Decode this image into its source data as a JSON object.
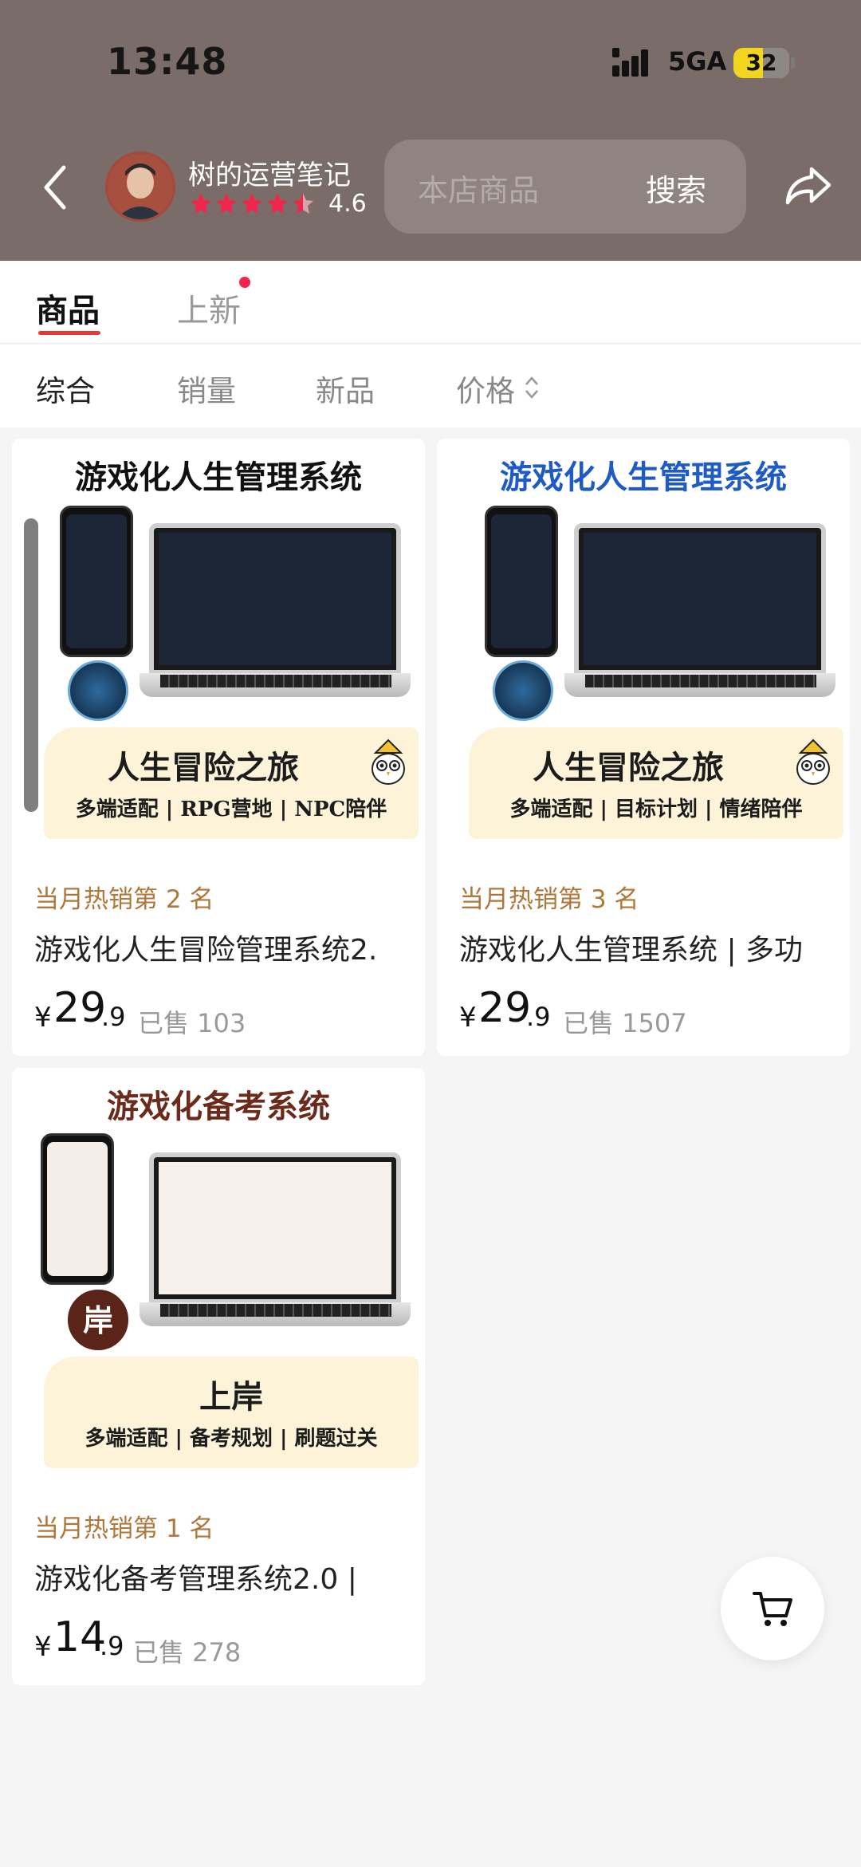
{
  "status_bar": {
    "time": "13:48",
    "network": "5GA",
    "battery": "32"
  },
  "header": {
    "shop_name": "树的运营笔记",
    "rating": "4.6",
    "search_placeholder": "本店商品",
    "search_button": "搜索"
  },
  "tabs": [
    {
      "label": "商品"
    },
    {
      "label": "上新"
    }
  ],
  "filters": [
    {
      "label": "综合"
    },
    {
      "label": "销量"
    },
    {
      "label": "新品"
    },
    {
      "label": "价格"
    }
  ],
  "products": [
    {
      "image_title": "游戏化人生管理系统",
      "image_title_color": "#111111",
      "banner_main": "人生冒险之旅",
      "banner_sub": "多端适配 | RPG营地 | NPC陪伴",
      "badge_text": "人生冒险之旅",
      "hot": "当月热销第 2 名",
      "title": "游戏化人生冒险管理系统2.",
      "price_symbol": "¥",
      "price_int": "29",
      "price_dec": ".9",
      "sold": "已售 103"
    },
    {
      "image_title": "游戏化人生管理系统",
      "image_title_color": "#1e5bc6",
      "banner_main": "人生冒险之旅",
      "banner_sub": "多端适配 | 目标计划 | 情绪陪伴",
      "badge_text": "人生冒险之旅",
      "hot": "当月热销第 3 名",
      "title": "游戏化人生管理系统 | 多功",
      "price_symbol": "¥",
      "price_int": "29",
      "price_dec": ".9",
      "sold": "已售 1507"
    },
    {
      "image_title": "游戏化备考系统",
      "image_title_color": "#6b2a1a",
      "banner_main": "上岸",
      "banner_sub": "多端适配 | 备考规划 | 刷题过关",
      "badge_text": "岸",
      "hot": "当月热销第 1 名",
      "title": "游戏化备考管理系统2.0 |",
      "price_symbol": "¥",
      "price_int": "14",
      "price_dec": ".9",
      "sold": "已售 278"
    }
  ],
  "colors": {
    "header_bg": "#7a6c69",
    "accent": "#e53935",
    "hot_text": "#b0773a"
  }
}
